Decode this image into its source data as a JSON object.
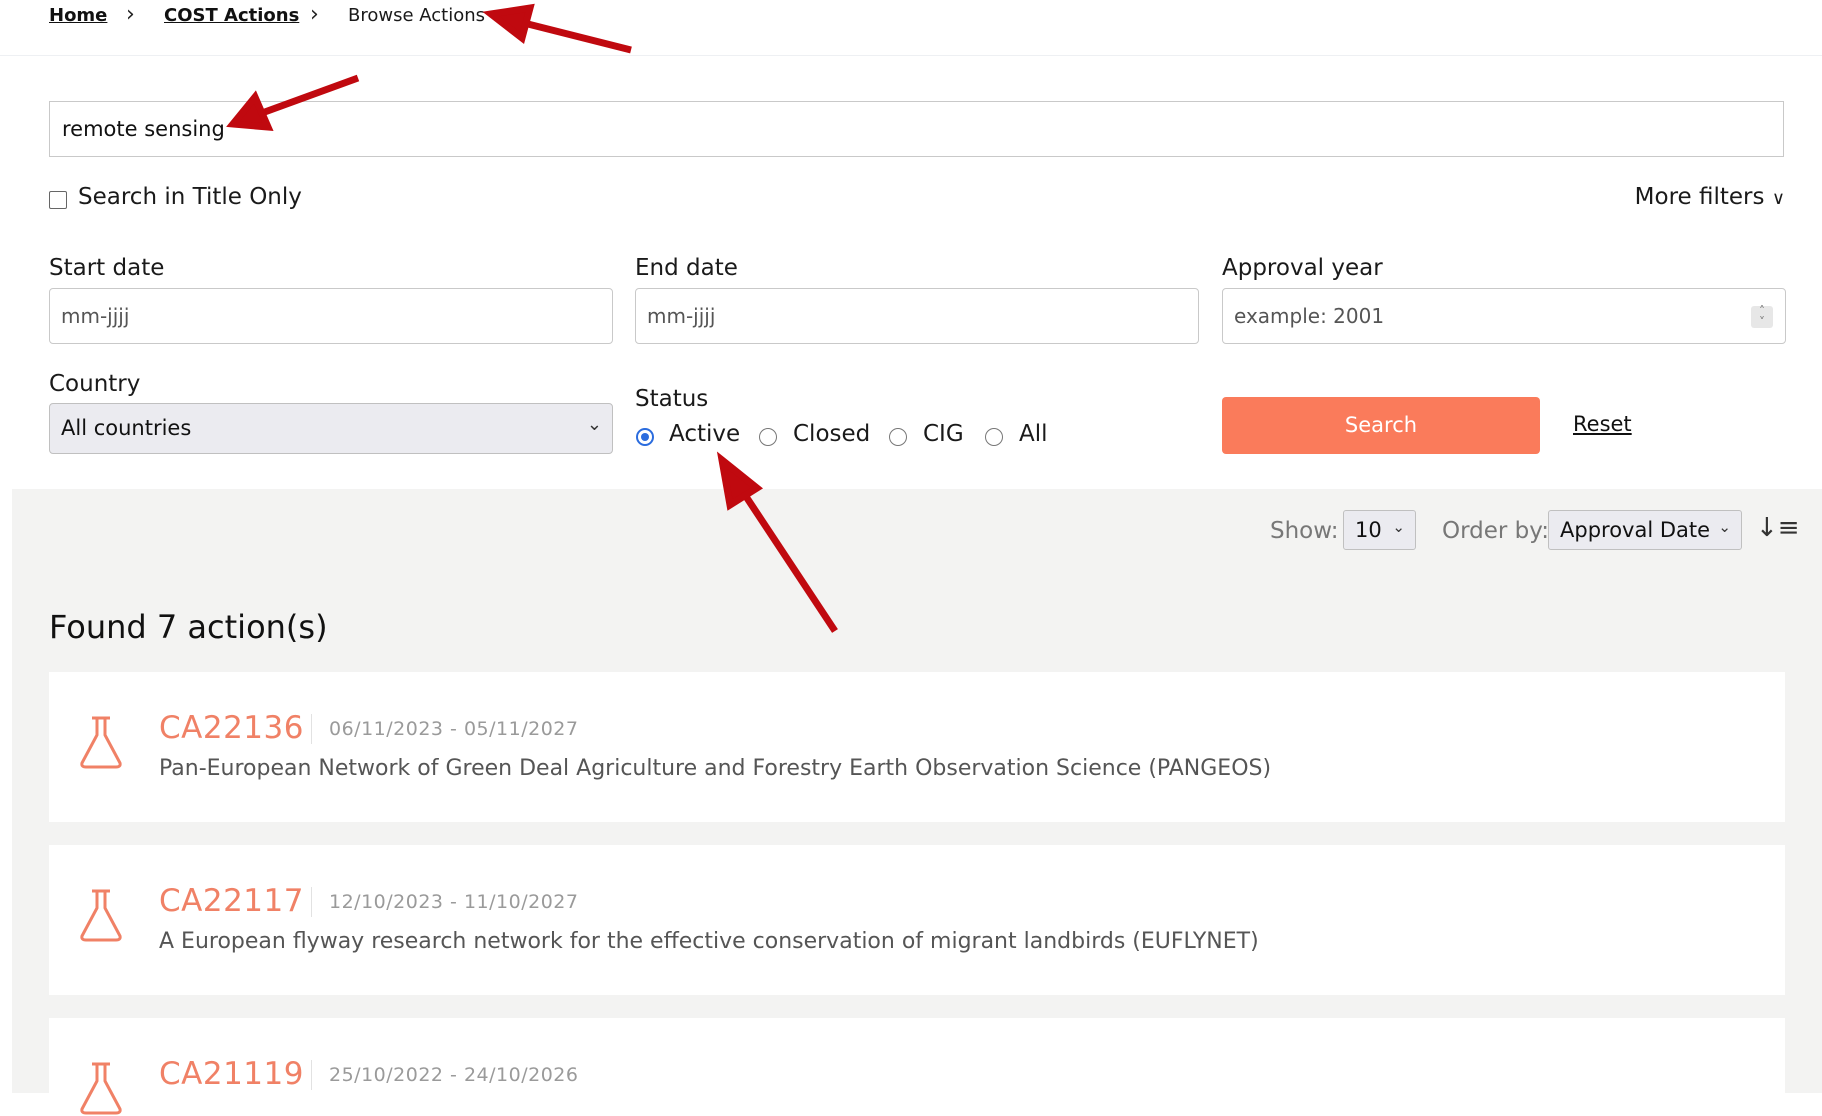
{
  "breadcrumb": {
    "home": "Home",
    "cost_actions": "COST Actions",
    "current": "Browse Actions",
    "separator": ">"
  },
  "search": {
    "value": "remote sensing",
    "title_only_label": "Search in Title Only",
    "title_only_checked": false,
    "more_filters": "More filters"
  },
  "filters": {
    "start_date_label": "Start date",
    "start_date_placeholder": "mm-jjjj",
    "end_date_label": "End date",
    "end_date_placeholder": "mm-jjjj",
    "approval_year_label": "Approval year",
    "approval_year_placeholder": "example: 2001",
    "country_label": "Country",
    "country_value": "All countries",
    "status_label": "Status",
    "status_options": [
      "Active",
      "Closed",
      "CIG",
      "All"
    ],
    "status_selected": "Active",
    "search_button": "Search",
    "reset_link": "Reset"
  },
  "results_toolbar": {
    "show_label": "Show:",
    "show_value": "10",
    "order_label": "Order by:",
    "order_value": "Approval Date"
  },
  "results": {
    "found_text": "Found 7 action(s)",
    "items": [
      {
        "code": "CA22136",
        "dates": "06/11/2023 - 05/11/2027",
        "title": "Pan-European Network of Green Deal Agriculture and Forestry Earth Observation Science (PANGEOS)"
      },
      {
        "code": "CA22117",
        "dates": "12/10/2023 - 11/10/2027",
        "title": "A European flyway research network for the effective conservation of migrant landbirds (EUFLYNET)"
      },
      {
        "code": "CA21119",
        "dates": "25/10/2022 - 24/10/2026",
        "title": ""
      }
    ]
  },
  "colors": {
    "accent": "#fa7b5b",
    "code_color": "#f08166",
    "annotation_arrow": "#c0090f",
    "radio_selected": "#2b6cde",
    "results_bg": "#f3f3f2"
  }
}
